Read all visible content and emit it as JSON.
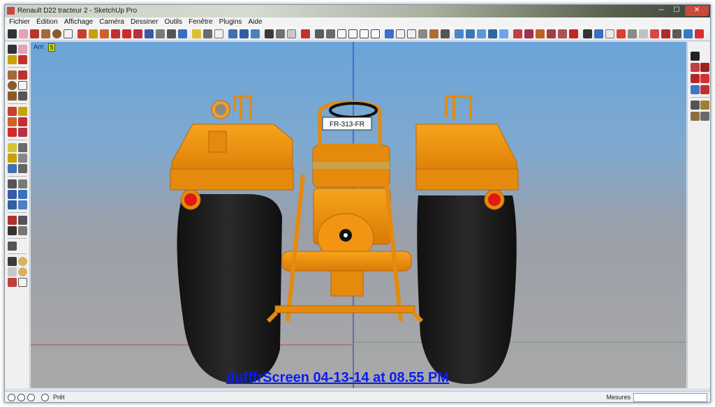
{
  "window": {
    "title": "Renault D22 tracteur 2 - SketchUp Pro"
  },
  "menu": [
    "Fichier",
    "Édition",
    "Affichage",
    "Caméra",
    "Dessiner",
    "Outils",
    "Fenêtre",
    "Plugins",
    "Aide"
  ],
  "viewport": {
    "scene_tab": "Arri",
    "scene_badge": "5",
    "license_plate": "FR-313-FR",
    "watermark": "dufffrScreen 04-13-14 at 08.55 PM"
  },
  "status": {
    "text": "Prêt",
    "measurements_label": "Mesures",
    "measurements_value": ""
  },
  "colors": {
    "sky_top": "#6aa4d9",
    "ground": "#a9a9a9",
    "tractor_orange": "#f2900f",
    "tire_black": "#1d1d1d",
    "watermark_blue": "#0a1df0",
    "close_red": "#c94a3b"
  }
}
